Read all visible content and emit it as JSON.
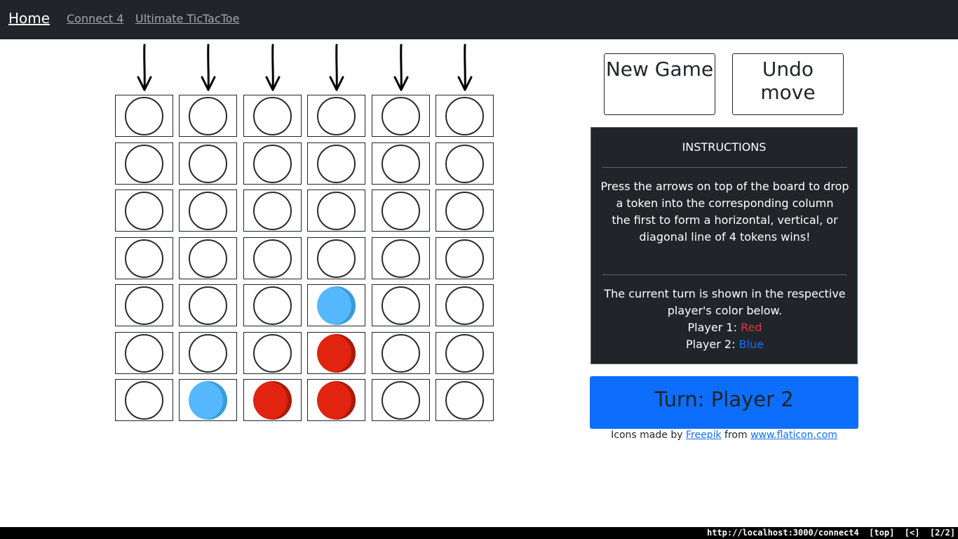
{
  "nav": {
    "home": "Home",
    "connect4": "Connect 4",
    "ultimate": "Ultimate TicTacToe"
  },
  "board": {
    "columns": 6,
    "rows": 7,
    "cells": [
      [
        "empty",
        "empty",
        "empty",
        "empty",
        "empty",
        "empty"
      ],
      [
        "empty",
        "empty",
        "empty",
        "empty",
        "empty",
        "empty"
      ],
      [
        "empty",
        "empty",
        "empty",
        "empty",
        "empty",
        "empty"
      ],
      [
        "empty",
        "empty",
        "empty",
        "empty",
        "empty",
        "empty"
      ],
      [
        "empty",
        "empty",
        "empty",
        "blue",
        "empty",
        "empty"
      ],
      [
        "empty",
        "empty",
        "empty",
        "red",
        "empty",
        "empty"
      ],
      [
        "empty",
        "blue",
        "red",
        "red",
        "empty",
        "empty"
      ]
    ],
    "arrow_icon": "down-arrow-icon"
  },
  "buttons": {
    "new_game": "New Game",
    "undo": "Undo move"
  },
  "instructions": {
    "title": "INSTRUCTIONS",
    "line1": "Press the arrows on top of the board to drop a token into the corresponding column",
    "line2": "the first to form a horizontal, vertical, or diagonal line of 4 tokens wins!",
    "turn_info": "The current turn is shown in the respective player's color below.",
    "player1_label": "Player 1:",
    "player1_color": "Red",
    "player2_label": "Player 2:",
    "player2_color": "Blue"
  },
  "turn": {
    "text": "Turn: Player 2"
  },
  "credit": {
    "prefix": "Icons made by",
    "author": "Freepik",
    "mid": "from",
    "site": "www.flaticon.com"
  },
  "statusbar": {
    "text": "http://localhost:3000/connect4  [top]  [<]  [2/2]"
  },
  "colors": {
    "navbar": "#212529",
    "red_token": "#e1240f",
    "blue_token": "#56b8fc",
    "turn_banner": "#0d6efd"
  }
}
